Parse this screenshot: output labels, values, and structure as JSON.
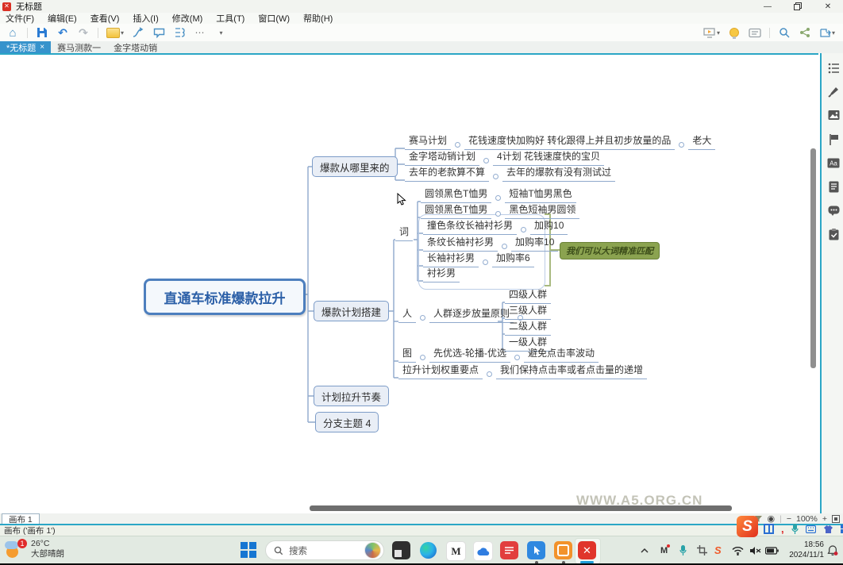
{
  "titlebar": {
    "title": "无标题",
    "minimize": "—",
    "close": "✕"
  },
  "menu": {
    "items": [
      "文件(F)",
      "编辑(E)",
      "查看(V)",
      "插入(I)",
      "修改(M)",
      "工具(T)",
      "窗口(W)",
      "帮助(H)"
    ]
  },
  "doc_tabs": {
    "tabs": [
      {
        "label": "*无标题"
      },
      {
        "label": "赛马测款一"
      },
      {
        "label": "金字塔动销"
      }
    ],
    "close": "×"
  },
  "mindmap": {
    "central": "直通车标准爆款拉升",
    "from": {
      "label": "爆款从哪里来的",
      "rows": [
        {
          "a": "赛马计划",
          "b": "花钱速度快加购好 转化跟得上并且初步放量的品",
          "c": "老大"
        },
        {
          "a": "金字塔动销计划",
          "b": "4计划 花钱速度快的宝贝"
        },
        {
          "a": "去年的老款算不算",
          "b": "去年的爆款有没有测试过"
        }
      ]
    },
    "build": {
      "label": "爆款计划搭建",
      "word": {
        "label": "词",
        "rows": [
          {
            "a": "圆领黑色T恤男",
            "b": "短袖T恤男黑色"
          },
          {
            "a": "圆领黑色T恤男",
            "b": "黑色短袖男圆领"
          },
          {
            "a": "撞色条纹长袖衬衫男",
            "b": "加购10"
          },
          {
            "a": "条纹长袖衬衫男",
            "b": "加购率10"
          },
          {
            "a": "长袖衬衫男",
            "b": "加购率6"
          },
          {
            "a": "衬衫男"
          }
        ],
        "callout": "我们可以大词精准匹配"
      },
      "people": {
        "label": "人",
        "principle": "人群逐步放量原则",
        "levels": [
          "四级人群",
          "三级人群",
          "二级人群",
          "一级人群"
        ]
      },
      "picture": {
        "label": "图",
        "a": "先优选-轮播-优选",
        "b": "避免点击率波动"
      },
      "weight": {
        "label": "拉升计划权重要点",
        "a": "我们保持点击率或者点击量的递增"
      }
    },
    "rhythm": "计划拉升节奏",
    "branch4": "分支主题 4"
  },
  "canvas": {
    "tab_label": "画布 1",
    "status": "画布 ('画布 1')",
    "zoom_out": "−",
    "zoom_level": "100%",
    "zoom_in": "+",
    "watermark": "WWW.A5.ORG.CN"
  },
  "taskbar": {
    "weather": {
      "temp": "26°C",
      "desc": "大部晴朗",
      "badge": "1"
    },
    "search_placeholder": "搜索",
    "clock": {
      "time": "18:56",
      "date": "2024/11/1"
    }
  }
}
